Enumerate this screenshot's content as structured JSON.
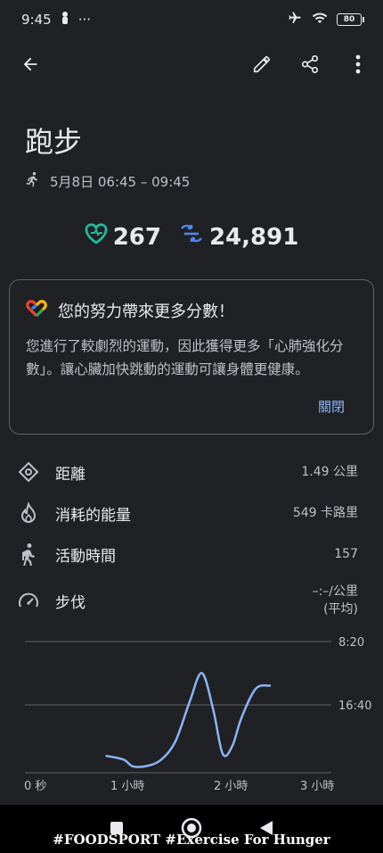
{
  "status_bar": {
    "time": "9:45",
    "dots": "···",
    "battery": "80",
    "icons": [
      "person-icon",
      "airplane-icon",
      "wifi-icon",
      "battery-icon"
    ]
  },
  "app_bar": {
    "icons": [
      "back-arrow-icon",
      "edit-pencil-icon",
      "share-icon",
      "more-vert-icon"
    ]
  },
  "activity": {
    "title": "跑步",
    "date_range": "5月8日 06:45 – 09:45"
  },
  "metrics": {
    "heart_points": "267",
    "steps": "24,891",
    "heart_color": "#1fbfa3",
    "steps_color": "#4f88e8"
  },
  "card": {
    "heading": "您的努力帶來更多分數！",
    "body": "您進行了較劇烈的運動，因此獲得更多「心肺強化分數」。讓心臟加快跳動的運動可讓身體更健康。",
    "action": "關閉"
  },
  "stats": [
    {
      "label": "距離",
      "value": "1.49 公里",
      "icon": "location-pin-icon"
    },
    {
      "label": "消耗的能量",
      "value": "549 卡路里",
      "icon": "flame-icon"
    },
    {
      "label": "活動時間",
      "value": "157",
      "icon": "walking-icon"
    },
    {
      "label": "步伐",
      "value": "–:–/公里",
      "value2": "(平均)",
      "icon": "speedometer-icon"
    }
  ],
  "chart_data": {
    "type": "line",
    "title": "",
    "xlabel": "",
    "ylabel": "",
    "x_ticks": [
      "0 秒",
      "1 小時",
      "2 小時",
      "3 小時"
    ],
    "y_ticks": [
      "8:20",
      "16:40"
    ],
    "x_range_hours": [
      0,
      3
    ],
    "y_range_min": [
      0,
      25
    ],
    "series": [
      {
        "color": "#8ab4f8",
        "x": [
          0.77,
          0.95,
          1.05,
          1.2,
          1.35,
          1.5,
          1.65,
          1.78,
          1.9,
          2.0,
          2.1,
          2.2,
          2.35,
          2.5
        ],
        "y": [
          3.2,
          2.5,
          1.2,
          1.3,
          2.5,
          6,
          13.5,
          19.0,
          12,
          3.6,
          5,
          10.5,
          16.0,
          16.6
        ]
      }
    ],
    "grid": true,
    "line_color": "#8ab4f8"
  },
  "nav_bar": {
    "icons": [
      "recents-square-icon",
      "home-circle-icon",
      "back-triangle-icon"
    ]
  },
  "watermark": "#FOODSPORT #Exercise For Hunger"
}
